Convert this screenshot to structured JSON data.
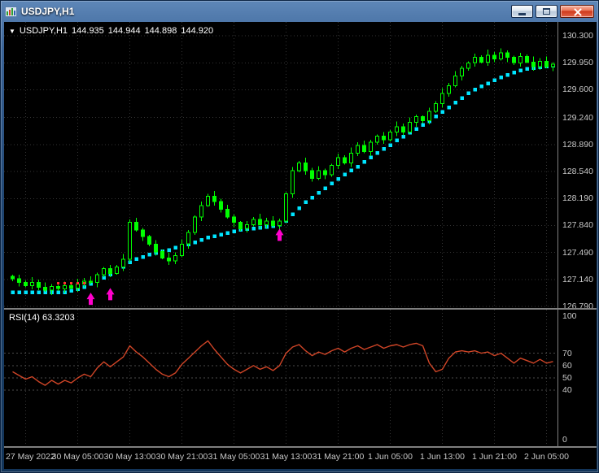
{
  "window": {
    "title": "USDJPY,H1",
    "buttons": [
      "minimize",
      "maximize",
      "close"
    ]
  },
  "chart": {
    "quote": {
      "marker": "▼",
      "symbol": "USDJPY,H1",
      "open": "144.935",
      "high": "144.944",
      "low": "144.898",
      "close": "144.920"
    },
    "price_axis": [
      "130.300",
      "129.950",
      "129.600",
      "129.240",
      "128.890",
      "128.540",
      "128.190",
      "127.840",
      "127.490",
      "127.140",
      "126.790"
    ],
    "rsi_label": "RSI(14) 63.3203",
    "rsi_axis": [
      100,
      70,
      60,
      50,
      40,
      0
    ],
    "time_axis": [
      "27 May 2022",
      "30 May 05:00",
      "30 May 13:00",
      "30 May 21:00",
      "31 May 05:00",
      "31 May 13:00",
      "31 May 21:00",
      "1 Jun 05:00",
      "1 Jun 13:00",
      "1 Jun 21:00",
      "2 Jun 05:00"
    ],
    "colors": {
      "background": "#000000",
      "candle": "#00ff00",
      "trend_dots": "#00e5ff",
      "buy_arrow": "#ff00cc",
      "signal_dots": "#ff3030",
      "rsi_line": "#d04527",
      "rsi_levels": "#4a4a4a",
      "grid": "#343434",
      "axis_text": "#c8c8c8",
      "pane_border": "#7f7f7f"
    }
  },
  "chart_data": [
    {
      "type": "candlestick",
      "title": "USDJPY H1",
      "ylim": [
        126.77,
        130.48
      ],
      "open_first": 127.18,
      "closes": [
        127.15,
        127.1,
        127.06,
        127.1,
        127.04,
        127,
        127.05,
        127.02,
        127.06,
        127.03,
        127.08,
        127.12,
        127.1,
        127.2,
        127.28,
        127.22,
        127.3,
        127.4,
        127.88,
        127.78,
        127.7,
        127.6,
        127.5,
        127.42,
        127.38,
        127.45,
        127.6,
        127.75,
        127.95,
        128.1,
        128.22,
        128.15,
        128.05,
        127.95,
        127.88,
        127.8,
        127.85,
        127.92,
        127.85,
        127.9,
        127.84,
        127.9,
        128.25,
        128.55,
        128.65,
        128.55,
        128.45,
        128.55,
        128.5,
        128.62,
        128.72,
        128.65,
        128.78,
        128.88,
        128.8,
        128.92,
        129,
        128.95,
        129.05,
        129.12,
        129.05,
        129.18,
        129.25,
        129.2,
        129.32,
        129.42,
        129.55,
        129.65,
        129.78,
        129.88,
        129.95,
        130.02,
        129.96,
        130.05,
        130,
        130.08,
        130.02,
        129.95,
        130.03,
        129.96,
        129.9,
        129.97,
        129.9,
        129.93
      ],
      "wick_high": [
        0.02,
        0.05,
        0.03,
        0.07,
        0.04,
        0.06,
        0.03
      ],
      "wick_low": [
        0.04,
        0.02,
        0.06,
        0.03,
        0.05,
        0.02,
        0.05
      ],
      "trend_dots": [
        126.97,
        126.97,
        126.97,
        126.97,
        126.97,
        126.97,
        126.97,
        126.97,
        126.97,
        126.99,
        127.01,
        127.04,
        127.08,
        127.12,
        127.16,
        127.2,
        127.25,
        127.3,
        127.36,
        127.4,
        127.43,
        127.46,
        127.48,
        127.5,
        127.52,
        127.55,
        127.56,
        127.59,
        127.62,
        127.65,
        127.68,
        127.7,
        127.72,
        127.74,
        127.76,
        127.78,
        127.79,
        127.8,
        127.81,
        127.82,
        127.83,
        127.85,
        127.9,
        127.98,
        128.06,
        128.14,
        128.2,
        128.26,
        128.32,
        128.38,
        128.44,
        128.5,
        128.55,
        128.6,
        128.66,
        128.72,
        128.78,
        128.83,
        128.88,
        128.94,
        128.99,
        129.04,
        129.09,
        129.14,
        129.19,
        129.25,
        129.31,
        129.37,
        129.43,
        129.49,
        129.55,
        129.6,
        129.64,
        129.68,
        129.72,
        129.76,
        129.79,
        129.82,
        129.85,
        129.87,
        129.88,
        129.89,
        129.9,
        129.91
      ],
      "buy_arrows": [
        {
          "bar": 12,
          "price": 126.99
        },
        {
          "bar": 15,
          "price": 127.05
        },
        {
          "bar": 41,
          "price": 127.82
        }
      ],
      "signal_dots": {
        "bars": [
          7,
          8,
          9,
          10,
          11
        ],
        "price": 127.09
      },
      "x_tick_bars": [
        2,
        10,
        18,
        26,
        34,
        42,
        50,
        58,
        66,
        74,
        82
      ]
    },
    {
      "type": "line",
      "name": "RSI(14)",
      "current_value": 63.3203,
      "ylim": [
        0,
        100
      ],
      "levels": [
        70,
        60,
        50,
        40
      ],
      "values": [
        55,
        52,
        49,
        51,
        47,
        44,
        48,
        45,
        48,
        46,
        50,
        53,
        51,
        58,
        63,
        59,
        63,
        67,
        76,
        71,
        67,
        62,
        57,
        53,
        51,
        54,
        61,
        66,
        71,
        76,
        80,
        73,
        67,
        61,
        57,
        54,
        57,
        60,
        57,
        59,
        56,
        60,
        70,
        75,
        77,
        72,
        68,
        71,
        69,
        72,
        74,
        71,
        74,
        76,
        73,
        75,
        77,
        74,
        76,
        77,
        75,
        77,
        78,
        76,
        62,
        55,
        57,
        66,
        71,
        72,
        71,
        72,
        70,
        71,
        68,
        70,
        66,
        62,
        66,
        64,
        62,
        65,
        62,
        63.32
      ]
    }
  ]
}
